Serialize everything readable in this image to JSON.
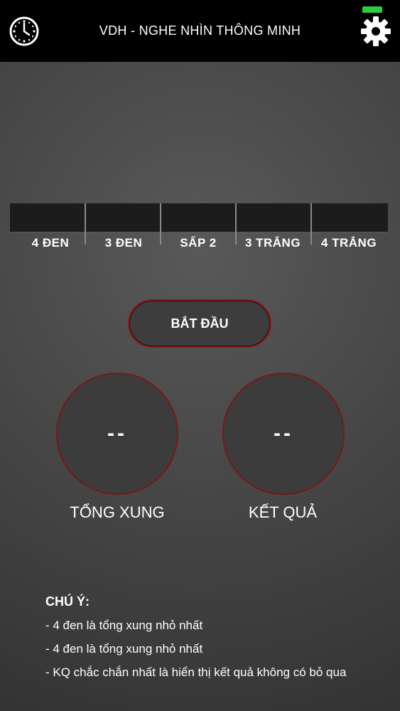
{
  "header": {
    "title": "VDH - NGHE NHÌN THÔNG MINH",
    "left_icon": "clock-icon",
    "right_icon": "gear-icon",
    "battery_color": "#2ecc40"
  },
  "meter": {
    "labels": [
      "4 ĐEN",
      "3 ĐEN",
      "SẤP 2",
      "3 TRẮNG",
      "4 TRẮNG"
    ]
  },
  "start_button": {
    "label": "BẮT ĐẦU",
    "border_color": "#8b1a1a"
  },
  "dials": {
    "total": {
      "value": "--",
      "label": "TỔNG XUNG"
    },
    "result": {
      "value": "--",
      "label": "KẾT QUẢ"
    }
  },
  "notes": {
    "title": "CHÚ Ý:",
    "lines": [
      "- 4 đen là tổng xung nhỏ nhất",
      "- 4 đen là tổng xung nhỏ nhất",
      "- KQ chắc chắn nhất là hiển thị kết quả không có bỏ qua"
    ]
  }
}
